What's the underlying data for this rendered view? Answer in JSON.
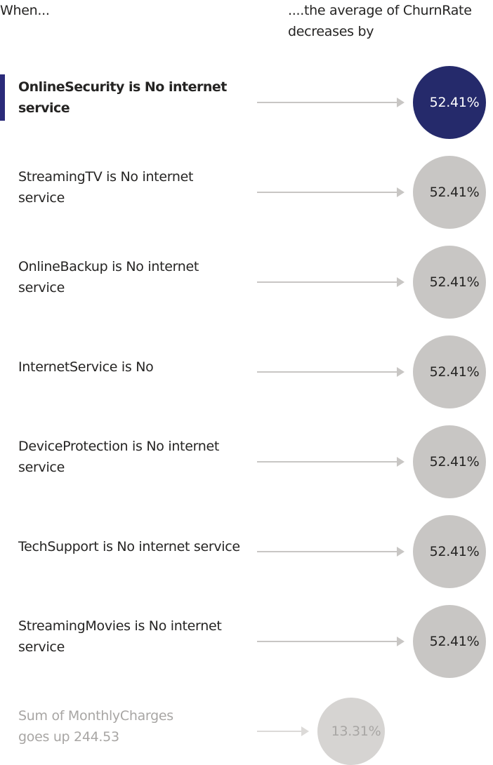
{
  "header": {
    "left_label": "When...",
    "right_label": "....the average of ChurnRate decreases by"
  },
  "colors": {
    "selected_bubble": "#252a6b",
    "default_bubble": "#c8c6c4",
    "muted_bubble": "#d6d4d2",
    "selected_bar": "#2b2b7a",
    "connector": "#c8c6c4",
    "text": "#252423",
    "muted_text": "#a8a6a4",
    "selected_bubble_text": "#ffffff",
    "default_bubble_text": "#252423",
    "muted_bubble_text": "#a8a6a4"
  },
  "influencers": [
    {
      "label": "OnlineSecurity is No internet service",
      "value": "52.41%",
      "selected": true
    },
    {
      "label": "StreamingTV is No internet service",
      "value": "52.41%",
      "selected": false
    },
    {
      "label": "OnlineBackup is No internet service",
      "value": "52.41%",
      "selected": false
    },
    {
      "label": "InternetService is No",
      "value": "52.41%",
      "selected": false
    },
    {
      "label": "DeviceProtection is No internet service",
      "value": "52.41%",
      "selected": false
    },
    {
      "label": "TechSupport is No internet service",
      "value": "52.41%",
      "selected": false
    },
    {
      "label": "StreamingMovies is No internet service",
      "value": "52.41%",
      "selected": false
    }
  ],
  "continuous_influencer": {
    "label": "Sum of MonthlyCharges",
    "sub_label": "goes up 244.53",
    "value": "13.31%"
  }
}
